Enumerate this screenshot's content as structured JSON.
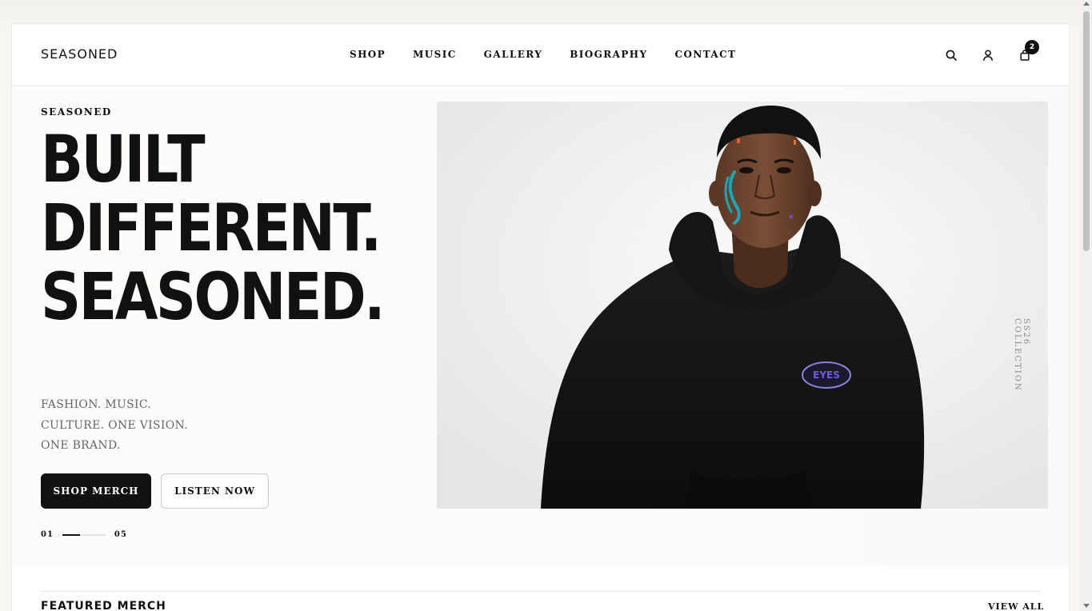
{
  "header": {
    "logo": "SEASONED",
    "nav": [
      "SHOP",
      "MUSIC",
      "GALLERY",
      "BIOGRAPHY",
      "CONTACT"
    ],
    "icons": [
      "search-icon",
      "user-icon",
      "bag-icon"
    ],
    "cart_count": "2"
  },
  "hero": {
    "eyebrow": "SEASONED",
    "headline": [
      "BUILT",
      "DIFFERENT.",
      "SEASONED."
    ],
    "tagline": [
      "FASHION. MUSIC.",
      "CULTURE. ONE VISION.",
      "ONE BRAND."
    ],
    "primary_button": "SHOP MERCH",
    "secondary_button": "LISTEN NOW",
    "slide_current": "01",
    "slide_total": "05",
    "slide_progress": 0.4,
    "image_side_label": "SS26 COLLECTION",
    "hoodie_logo": "EYES"
  },
  "featured": {
    "title": "FEATURED MERCH",
    "view_all": "VIEW ALL"
  }
}
